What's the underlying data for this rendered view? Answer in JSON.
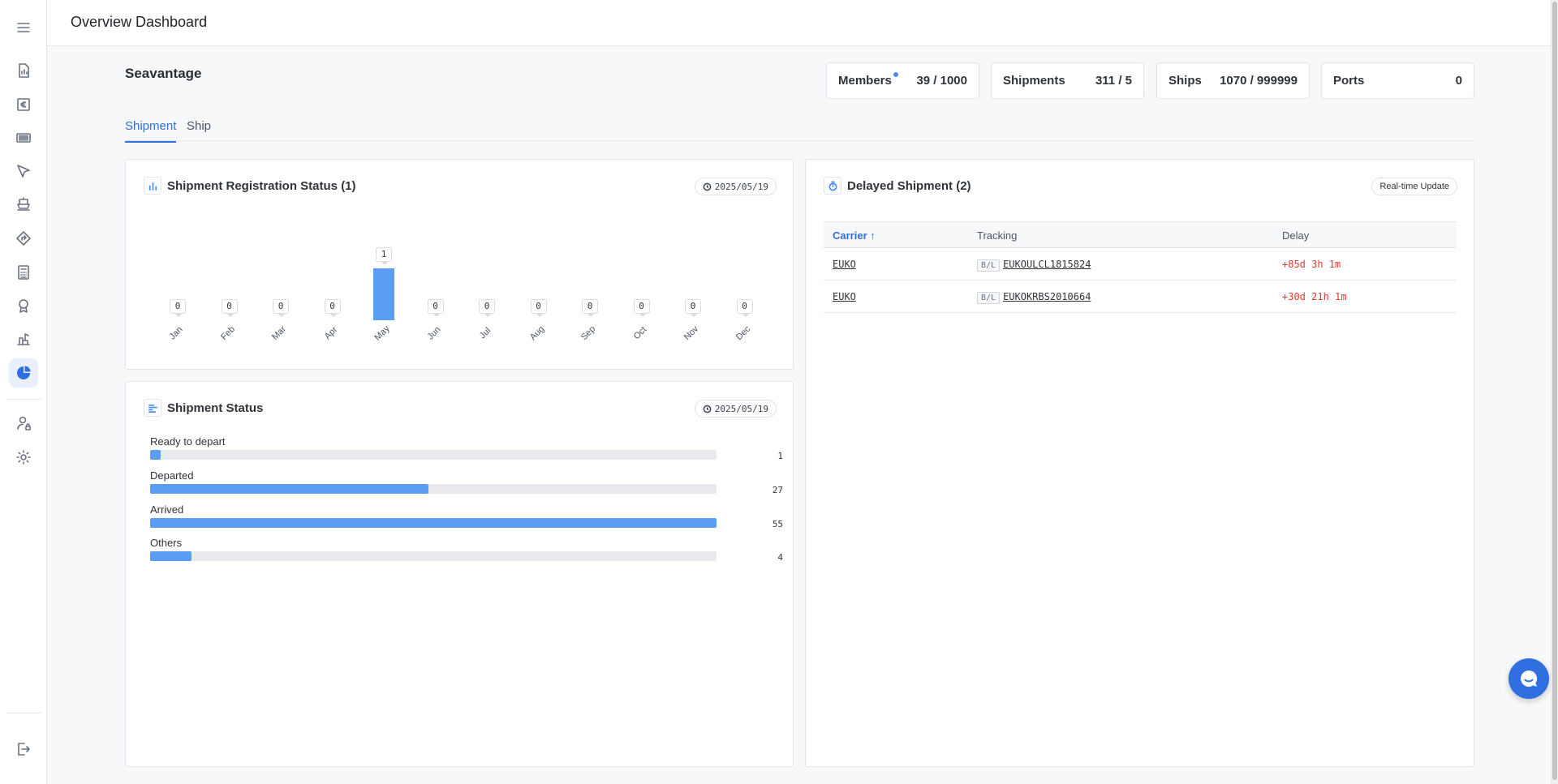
{
  "header": {
    "title": "Overview Dashboard"
  },
  "org": {
    "name": "Seavantage"
  },
  "stats": [
    {
      "label": "Members",
      "value": "39 / 1000",
      "has_dot": true
    },
    {
      "label": "Shipments",
      "value": "311 / 5"
    },
    {
      "label": "Ships",
      "value": "1070 / 999999"
    },
    {
      "label": "Ports",
      "value": "0"
    }
  ],
  "tabs": [
    {
      "label": "Shipment",
      "active": true
    },
    {
      "label": "Ship",
      "active": false
    }
  ],
  "registration": {
    "title": "Shipment Registration Status (1)",
    "date": "2025/05/19"
  },
  "status": {
    "title": "Shipment Status",
    "date": "2025/05/19",
    "max": 55,
    "rows": [
      {
        "name": "Ready to depart",
        "value": 1
      },
      {
        "name": "Departed",
        "value": 27
      },
      {
        "name": "Arrived",
        "value": 55
      },
      {
        "name": "Others",
        "value": 4
      }
    ]
  },
  "delayed": {
    "title": "Delayed Shipment (2)",
    "badge": "Real-time Update",
    "columns": [
      "Carrier",
      "Tracking",
      "Delay"
    ],
    "sort_arrow": "↑",
    "tag": "B/L",
    "rows": [
      {
        "carrier": "EUKO",
        "tracking": "EUKOULCL1815824",
        "delay": "+85d 3h 1m"
      },
      {
        "carrier": "EUKO",
        "tracking": "EUKOKRBS2010664",
        "delay": "+30d 21h 1m"
      }
    ]
  },
  "chart_data": {
    "type": "bar",
    "categories": [
      "Jan",
      "Feb",
      "Mar",
      "Apr",
      "May",
      "Jun",
      "Jul",
      "Aug",
      "Sep",
      "Oct",
      "Nov",
      "Dec"
    ],
    "values": [
      0,
      0,
      0,
      0,
      1,
      0,
      0,
      0,
      0,
      0,
      0,
      0
    ],
    "title": "Shipment Registration Status (1)",
    "xlabel": "",
    "ylabel": "",
    "ylim": [
      0,
      1
    ],
    "grid": false,
    "color": "#5b9df2"
  },
  "colors": {
    "accent": "#2f6fe0",
    "bar": "#5b9df2",
    "delay": "#e5392b"
  },
  "sidebar": {
    "items": [
      {
        "icon": "menu-icon"
      },
      {
        "icon": "report-icon"
      },
      {
        "icon": "invoice-icon"
      },
      {
        "icon": "barcode-icon"
      },
      {
        "icon": "send-icon"
      },
      {
        "icon": "ship-icon"
      },
      {
        "icon": "route-icon"
      },
      {
        "icon": "calculator-icon"
      },
      {
        "icon": "award-icon"
      },
      {
        "icon": "port-icon"
      },
      {
        "icon": "pie-chart-icon",
        "active": true
      },
      {
        "icon": "user-lock-icon"
      },
      {
        "icon": "settings-icon"
      },
      {
        "icon": "logout-icon"
      }
    ]
  }
}
